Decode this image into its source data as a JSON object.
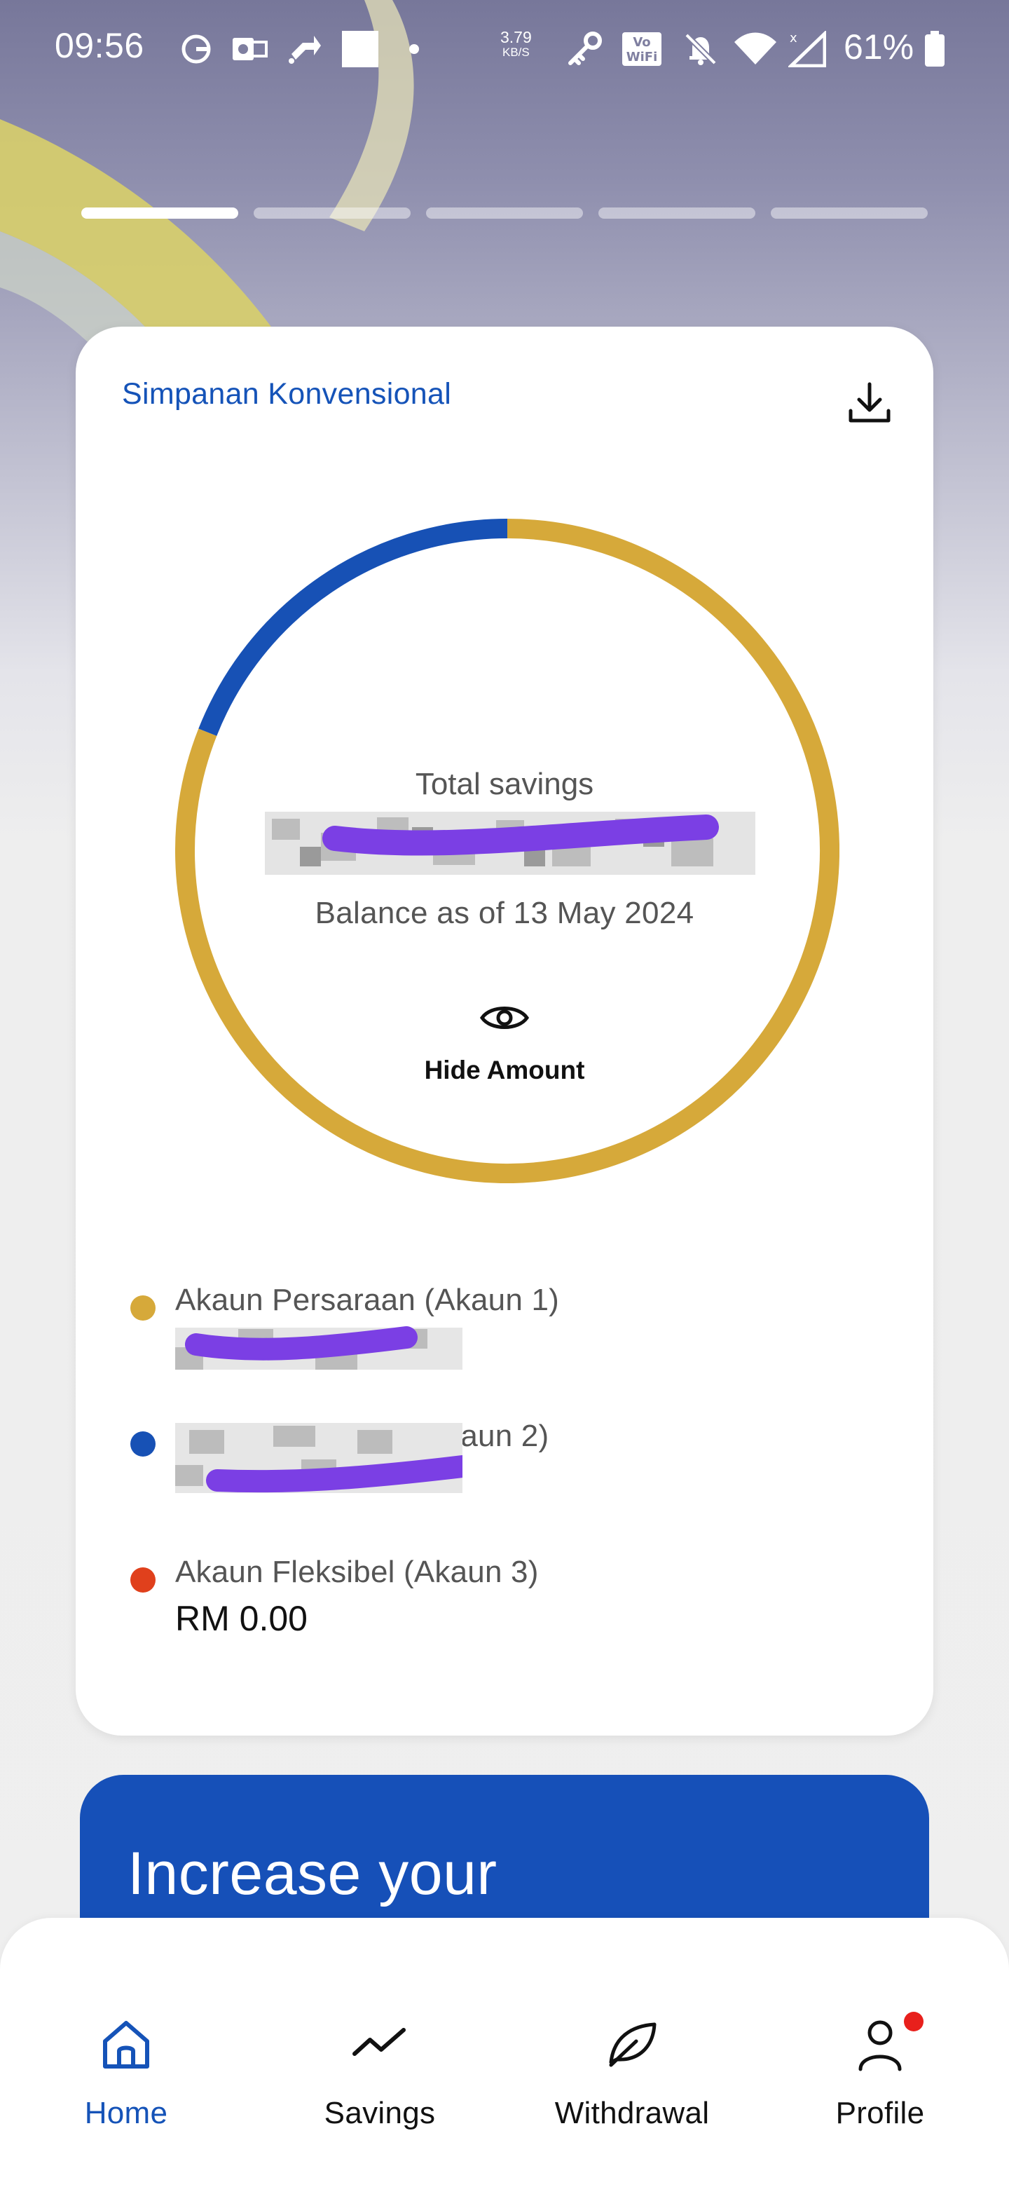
{
  "status_bar": {
    "time": "09:56",
    "speed_value": "3.79",
    "speed_unit": "KB/S",
    "battery_percent": "61%",
    "icons": [
      "g-app-icon",
      "outlook-icon",
      "cast-icon",
      "notification-icon",
      "square-icon",
      "dot-icon",
      "key-icon",
      "vowifi-icon",
      "bell-off-icon",
      "wifi-icon",
      "signal-icon",
      "battery-icon"
    ]
  },
  "story_progress": {
    "segments": 5,
    "active_index": 0
  },
  "card": {
    "title": "Simpanan Konvensional",
    "total_label": "Total savings",
    "total_amount_visible": false,
    "balance_label": "Balance as of 13 May 2024",
    "hide_amount_label": "Hide Amount"
  },
  "colors": {
    "accent_blue": "#1553b8",
    "gold": "#d6a93a",
    "donut_blue": "#1751b5",
    "flexible_red": "#e0401c"
  },
  "chart_data": {
    "type": "pie",
    "series": [
      {
        "name": "Akaun Persaraan (Akaun 1)",
        "fraction": 0.81,
        "color": "#d6a93a"
      },
      {
        "name": "Akaun Sejahtera (Akaun 2)",
        "fraction": 0.19,
        "color": "#1751b5"
      },
      {
        "name": "Akaun Fleksibel (Akaun 3)",
        "fraction": 0.0,
        "color": "#e0401c"
      }
    ]
  },
  "legend": [
    {
      "name": "Akaun Persaraan (Akaun 1)",
      "value": "",
      "color": "#d6a93a",
      "redacted": true
    },
    {
      "name": "Akaun Sejahtera (Akaun 2)",
      "value": "",
      "color": "#1751b5",
      "redacted": true
    },
    {
      "name": "Akaun Fleksibel (Akaun 3)",
      "value": "RM 0.00",
      "color": "#e0401c",
      "redacted": false
    }
  ],
  "promo": {
    "text": "Increase your"
  },
  "nav": {
    "items": [
      {
        "label": "Home",
        "icon": "home-icon",
        "active": true
      },
      {
        "label": "Savings",
        "icon": "trend-icon",
        "active": false
      },
      {
        "label": "Withdrawal",
        "icon": "leaf-icon",
        "active": false
      },
      {
        "label": "Profile",
        "icon": "profile-icon",
        "active": false,
        "has_notification": true
      }
    ]
  }
}
